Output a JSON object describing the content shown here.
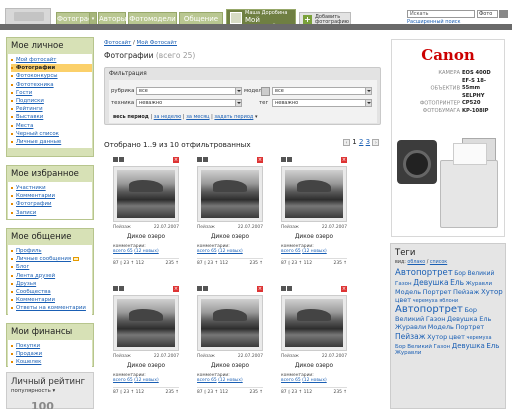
{
  "nav": {
    "tabs": [
      "Фотографии",
      "Авторы",
      "Фотомодели",
      "Общение"
    ],
    "active_tab": {
      "user": "Маша Доробина",
      "title": "Мой Фотосайт"
    },
    "add_button": {
      "line1": "Добавить",
      "line2": "фотографию"
    },
    "search_placeholder": "Искать",
    "search_scope": "Фото",
    "advanced_search": "Расширенный поиск"
  },
  "sidebar": {
    "personal": {
      "title": "Мое личное",
      "items": [
        "Мой фотосайт",
        "Фотографии",
        "Фотоконкурсы",
        "Фототехника",
        "Гости",
        "Подписки",
        "Рейтинги",
        "Выставки",
        "Места",
        "Черный список",
        "Личные данные"
      ],
      "selected_index": 1
    },
    "favorites": {
      "title": "Мое избранное",
      "items": [
        "Участники",
        "Комментарии",
        "Фотографии",
        "Записи"
      ]
    },
    "communication": {
      "title": "Мое общение",
      "items": [
        "Профиль",
        "Личные сообщения",
        "Блог",
        "Лента друзей",
        "Друзья",
        "Сообщества",
        "Комментарии",
        "Ответы на комментарии"
      ]
    },
    "finances": {
      "title": "Мои финансы",
      "items": [
        "Покупки",
        "Продажи",
        "Кошелек"
      ]
    },
    "rating": {
      "title": "Личный рейтинг",
      "popularity": "популярность",
      "value": "100"
    }
  },
  "main": {
    "breadcrumb": [
      "Фотосайт",
      "Мой Фотосайт"
    ],
    "title": "Фотографии",
    "count": "(всего 25)",
    "filter": {
      "title": "Фильтрация",
      "rubric_label": "рубрика",
      "rubric_value": "все",
      "model_label": "модель",
      "model_value": "все",
      "technique_label": "техника",
      "technique_value": "неважно",
      "tag_label": "тег",
      "tag_value": "неважно",
      "period_all": "весь период",
      "period_week": "за неделю",
      "period_month": "за месяц",
      "period_custom": "задать период"
    },
    "shown_text": "Отобрано 1..9 из 10 отфильтрованных",
    "pager": {
      "pages": [
        "1",
        "2",
        "3"
      ],
      "current": "1"
    },
    "photos": [
      {
        "category": "Пейзаж",
        "date": "22.07.2007",
        "title": "Дикое озеро",
        "comments_label": "комментарии:",
        "comments": "всего 65",
        "new": "(12 новых)",
        "views": "87 ◊ 23 ↑ 112",
        "score": "235 ↑"
      },
      {
        "category": "Пейзаж",
        "date": "22.07.2007",
        "title": "Дикое озеро",
        "comments_label": "комментарии:",
        "comments": "всего 65",
        "new": "(12 новых)",
        "views": "87 ◊ 23 ↑ 112",
        "score": "235 ↑"
      },
      {
        "category": "Пейзаж",
        "date": "22.07.2007",
        "title": "Дикое озеро",
        "comments_label": "комментарии:",
        "comments": "всего 65",
        "new": "(12 новых)",
        "views": "87 ◊ 23 ↑ 112",
        "score": "235 ↑"
      },
      {
        "category": "Пейзаж",
        "date": "22.07.2007",
        "title": "Дикое озеро",
        "comments_label": "комментарии:",
        "comments": "всего 65",
        "new": "(12 новых)",
        "views": "87 ◊ 23 ↑ 112",
        "score": "235 ↑"
      },
      {
        "category": "Пейзаж",
        "date": "22.07.2007",
        "title": "Дикое озеро",
        "comments_label": "комментарии:",
        "comments": "всего 65",
        "new": "(12 новых)",
        "views": "87 ◊ 23 ↑ 112",
        "score": "235 ↑"
      },
      {
        "category": "Пейзаж",
        "date": "22.07.2007",
        "title": "Дикое озеро",
        "comments_label": "комментарии:",
        "comments": "всего 65",
        "new": "(12 новых)",
        "views": "87 ◊ 23 ↑ 112",
        "score": "235 ↑"
      }
    ]
  },
  "ad": {
    "brand": "Canon",
    "specs": [
      {
        "k": "КАМЕРА",
        "v": "EOS 400D"
      },
      {
        "k": "ОБЪЕКТИВ",
        "v": "EF-S 18-55mm"
      },
      {
        "k": "ФОТОПРИНТЕР",
        "v": "SELPHY CP520"
      },
      {
        "k": "ФОТОБУМАГА",
        "v": "KP-108IP"
      }
    ]
  },
  "tags": {
    "title": "Теги",
    "view_label": "вид:",
    "view_cloud": "облако",
    "view_sep": "/",
    "view_list": "список",
    "cloud": [
      {
        "t": "Автопортрет",
        "s": 8.5
      },
      {
        "t": "Бор",
        "s": 6
      },
      {
        "t": "Великий",
        "s": 6
      },
      {
        "t": "Газон",
        "s": 5.5
      },
      {
        "t": "Девушка",
        "s": 7.5
      },
      {
        "t": "Ель",
        "s": 7.5
      },
      {
        "t": "Журавли",
        "s": 5.5
      },
      {
        "t": "Модель",
        "s": 6.5
      },
      {
        "t": "Портрет",
        "s": 6.5
      },
      {
        "t": "Пейзаж",
        "s": 6.5
      },
      {
        "t": "Хутор",
        "s": 7
      },
      {
        "t": "цвет",
        "s": 6.5
      },
      {
        "t": "черемуха",
        "s": 5
      },
      {
        "t": "яблони",
        "s": 5
      },
      {
        "t": "Автопортрет",
        "s": 10
      },
      {
        "t": "Бор",
        "s": 6.5
      },
      {
        "t": "Великий",
        "s": 6.5
      },
      {
        "t": "Газон",
        "s": 6.5
      },
      {
        "t": "Девушка",
        "s": 6.5
      },
      {
        "t": "Ель",
        "s": 6.5
      },
      {
        "t": "Журавли",
        "s": 6.5
      },
      {
        "t": "Модель",
        "s": 6.5
      },
      {
        "t": "Портрет",
        "s": 6.5
      },
      {
        "t": "Пейзаж",
        "s": 7.5
      },
      {
        "t": "Хутор",
        "s": 6.5
      },
      {
        "t": "цвет",
        "s": 6.5
      },
      {
        "t": "черемуха",
        "s": 5
      },
      {
        "t": "Бор",
        "s": 5.5
      },
      {
        "t": "Великий",
        "s": 5.5
      },
      {
        "t": "Газон",
        "s": 5.5
      },
      {
        "t": "Девушка",
        "s": 7
      },
      {
        "t": "Ель",
        "s": 7
      },
      {
        "t": "Журавли",
        "s": 5.5
      }
    ]
  }
}
